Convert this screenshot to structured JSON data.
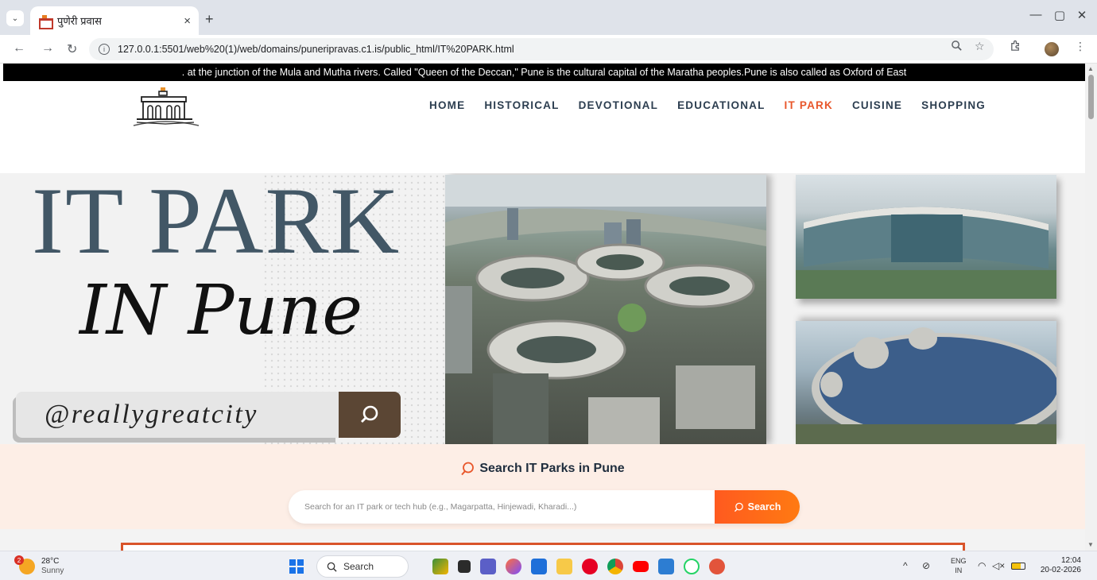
{
  "browser": {
    "tab_title": "पुणेरी प्रवास",
    "tab_close": "×",
    "new_tab": "+",
    "url": "127.0.0.1:5501/web%20(1)/web/domains/puneripravas.c1.is/public_html/IT%20PARK.html",
    "window_controls": {
      "minimize": "—",
      "restore": "▢",
      "close": "✕"
    }
  },
  "site": {
    "ticker": ". at the junction of the Mula and Mutha rivers. Called \"Queen of the Deccan,\" Pune is the cultural capital of the Maratha peoples.Pune is also called as Oxford of East",
    "nav": [
      {
        "label": "HOME",
        "active": false
      },
      {
        "label": "HISTORICAL",
        "active": false
      },
      {
        "label": "DEVOTIONAL",
        "active": false
      },
      {
        "label": "EDUCATIONAL",
        "active": false
      },
      {
        "label": "IT PARK",
        "active": true
      },
      {
        "label": "CUISINE",
        "active": false
      },
      {
        "label": "SHOPPING",
        "active": false
      }
    ],
    "hero": {
      "title": "IT PARK",
      "script": "IN Pune",
      "handle": "@reallygreatcity"
    },
    "search": {
      "heading": "Search IT Parks in Pune",
      "placeholder": "Search for an IT park or tech hub (e.g., Magarpatta, Hinjewadi, Kharadi...)",
      "button": "Search"
    },
    "colors": {
      "accent": "#e8562a",
      "nav_text": "#2c3e50",
      "search_section_bg": "#fdeee6"
    }
  },
  "taskbar": {
    "weather_badge": "2",
    "temperature": "28°C",
    "condition": "Sunny",
    "search_label": "Search",
    "lang_line1": "ENG",
    "lang_line2": "IN",
    "time": "12:04",
    "date": "20-02-2026"
  }
}
